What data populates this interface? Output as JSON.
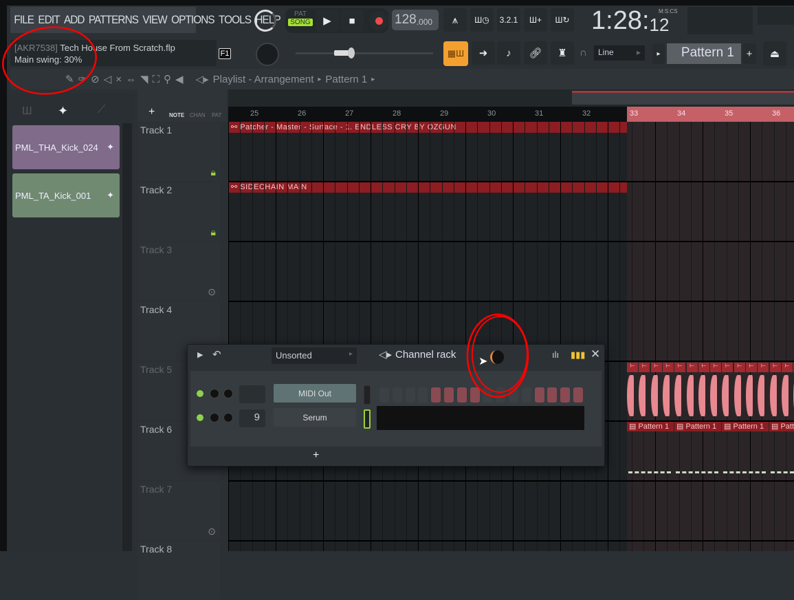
{
  "menu": [
    "FILE",
    "EDIT",
    "ADD",
    "PATTERNS",
    "VIEW",
    "OPTIONS",
    "TOOLS",
    "HELP"
  ],
  "transport": {
    "pat": "PAT",
    "song": "SONG",
    "tempo": "128",
    "tempo_dec": ".000",
    "time_main": "1:28:",
    "time_cs": "12",
    "time_format": "M:S:CS",
    "accent": "#a6e22e"
  },
  "info": {
    "tag": "[AKR7538]",
    "project": "Tech House From Scratch.flp",
    "hint": "Main swing: 30%",
    "f1": "F1"
  },
  "toolbar": {
    "snap": "Line",
    "pattern": "Pattern 1",
    "plus": "+",
    "breadcrumb": [
      "Playlist - Arrangement",
      "Pattern 1"
    ]
  },
  "browser": {
    "samples": [
      {
        "name": "PML_THA_Kick_024",
        "color": "#806b8a"
      },
      {
        "name": "PML_TA_Kick_001",
        "color": "#6f8a70"
      }
    ]
  },
  "track_tabs": {
    "add": "+",
    "note": "NOTE",
    "chan": "CHAN",
    "pat": "PAT"
  },
  "tracks": [
    "Track 1",
    "Track 2",
    "Track 3",
    "Track 4",
    "Track 5",
    "Track 6",
    "Track 7",
    "Track 8"
  ],
  "ruler": [
    "25",
    "26",
    "27",
    "28",
    "29",
    "30",
    "31",
    "32",
    "33",
    "34",
    "35",
    "36"
  ],
  "clips": {
    "t1": "Patcher - Master - Surface - 1. ENDLESS CRY BY OZGUN",
    "t2": "SIDECHAIN MAIN",
    "pattern": "Pattern 1"
  },
  "channel_rack": {
    "filter": "Unsorted",
    "title": "Channel rack",
    "add": "+",
    "channels": [
      {
        "name": "MIDI Out",
        "number": ""
      },
      {
        "name": "Serum",
        "number": "9"
      }
    ],
    "steps": [
      0,
      0,
      0,
      0,
      1,
      1,
      1,
      1,
      0,
      0,
      0,
      0,
      1,
      1,
      1,
      1
    ]
  }
}
